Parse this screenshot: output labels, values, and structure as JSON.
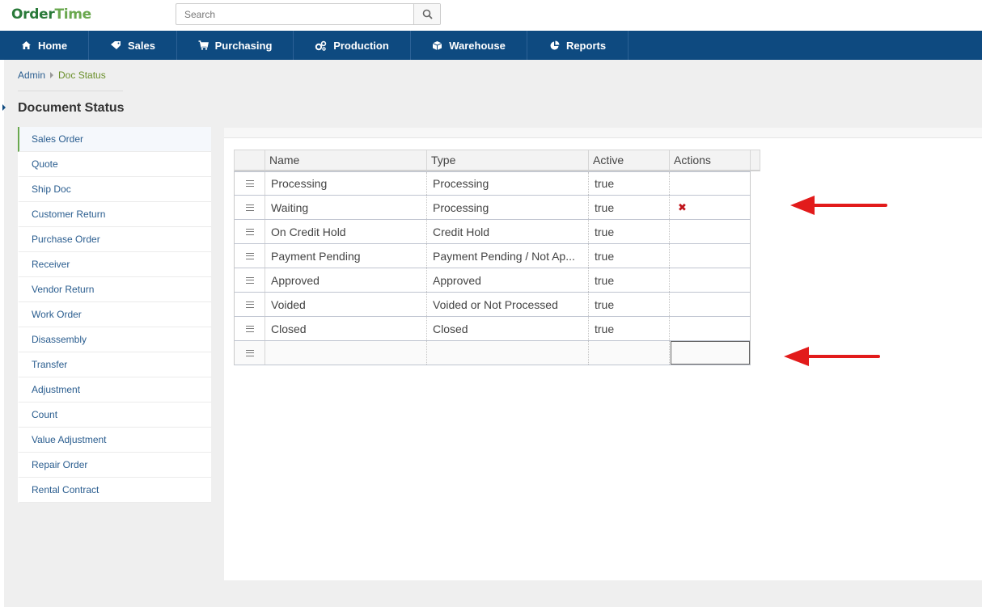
{
  "brand": {
    "logo_o": "O",
    "logo_rder": "rder",
    "logo_time": "Time"
  },
  "search": {
    "placeholder": "Search"
  },
  "nav": [
    {
      "label": "Home",
      "icon": "home-icon"
    },
    {
      "label": "Sales",
      "icon": "tag-icon"
    },
    {
      "label": "Purchasing",
      "icon": "cart-icon"
    },
    {
      "label": "Production",
      "icon": "gears-icon"
    },
    {
      "label": "Warehouse",
      "icon": "box-icon"
    },
    {
      "label": "Reports",
      "icon": "pie-chart-icon"
    }
  ],
  "breadcrumb": {
    "root": "Admin",
    "current": "Doc Status"
  },
  "page": {
    "title": "Document Status"
  },
  "sidebar": {
    "active": "Sales Order",
    "items": [
      "Sales Order",
      "Quote",
      "Ship Doc",
      "Customer Return",
      "Purchase Order",
      "Receiver",
      "Vendor Return",
      "Work Order",
      "Disassembly",
      "Transfer",
      "Adjustment",
      "Count",
      "Value Adjustment",
      "Repair Order",
      "Rental Contract"
    ]
  },
  "grid": {
    "headers": {
      "name": "Name",
      "type": "Type",
      "active": "Active",
      "actions": "Actions"
    },
    "rows": [
      {
        "name": "Processing",
        "type": "Processing",
        "active": "true",
        "delete": false
      },
      {
        "name": "Waiting",
        "type": "Processing",
        "active": "true",
        "delete": true
      },
      {
        "name": "On Credit Hold",
        "type": "Credit Hold",
        "active": "true",
        "delete": false
      },
      {
        "name": "Payment Pending",
        "type": "Payment Pending / Not Ap...",
        "active": "true",
        "delete": false
      },
      {
        "name": "Approved",
        "type": "Approved",
        "active": "true",
        "delete": false
      },
      {
        "name": "Voided",
        "type": "Voided or Not Processed",
        "active": "true",
        "delete": false
      },
      {
        "name": "Closed",
        "type": "Closed",
        "active": "true",
        "delete": false
      }
    ],
    "delete_glyph": "✖"
  },
  "colors": {
    "nav_bg": "#0e4a80",
    "brand_green": "#2a7a3a",
    "brand_light_green": "#6aa84f",
    "delete_red": "#c0141b",
    "arrow_red": "#e21b1b"
  }
}
